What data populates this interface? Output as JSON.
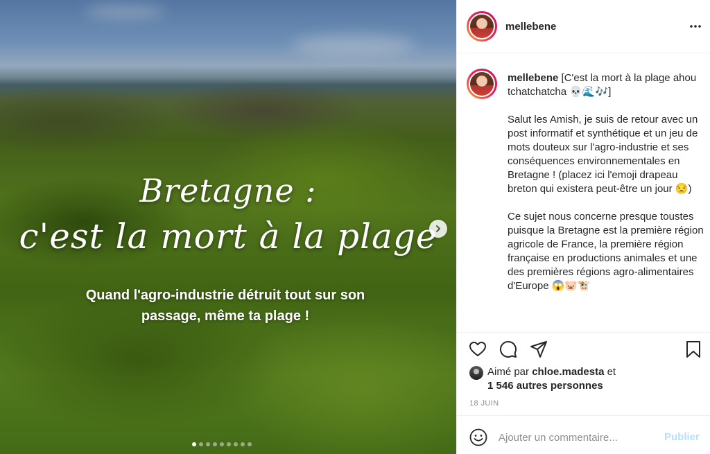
{
  "post": {
    "slide": {
      "title_line1": "Bretagne :",
      "title_line2": "c'est la mort à la plage",
      "subtitle_line1": "Quand l'agro-industrie détruit tout sur son",
      "subtitle_line2": "passage, même ta plage !",
      "slide_count": 9,
      "active_slide": 1
    },
    "header": {
      "username": "mellebene",
      "more_icon": "more-options-icon"
    },
    "caption": {
      "username": "mellebene",
      "p1": "[C'est la mort à la plage ahou tchatchatcha 💀🌊🎶]",
      "p2": "Salut les Amish, je suis de retour avec un post informatif et synthétique et un jeu de mots douteux sur l'agro-industrie et ses conséquences environnementales en Bretagne ! (placez ici l'emoji drapeau breton qui existera peut-être un jour 😒)",
      "p3": "Ce sujet nous concerne presque toustes puisque la Bretagne est la première région agricole de France, la première région française en productions animales et une des premières régions agro-alimentaires d'Europe 😱🐷🐮"
    },
    "actions": {
      "icons": [
        "heart-icon",
        "comment-icon",
        "share-icon",
        "bookmark-icon"
      ],
      "liked_by_prefix": "Aimé par",
      "liked_by_user": "chloe.madesta",
      "liked_by_suffix": "et",
      "likes_count": "1 546 autres personnes",
      "date": "18 JUIN"
    },
    "comment": {
      "placeholder": "Ajouter un commentaire...",
      "publish_label": "Publier",
      "emoji_icon": "smiley-icon"
    }
  }
}
